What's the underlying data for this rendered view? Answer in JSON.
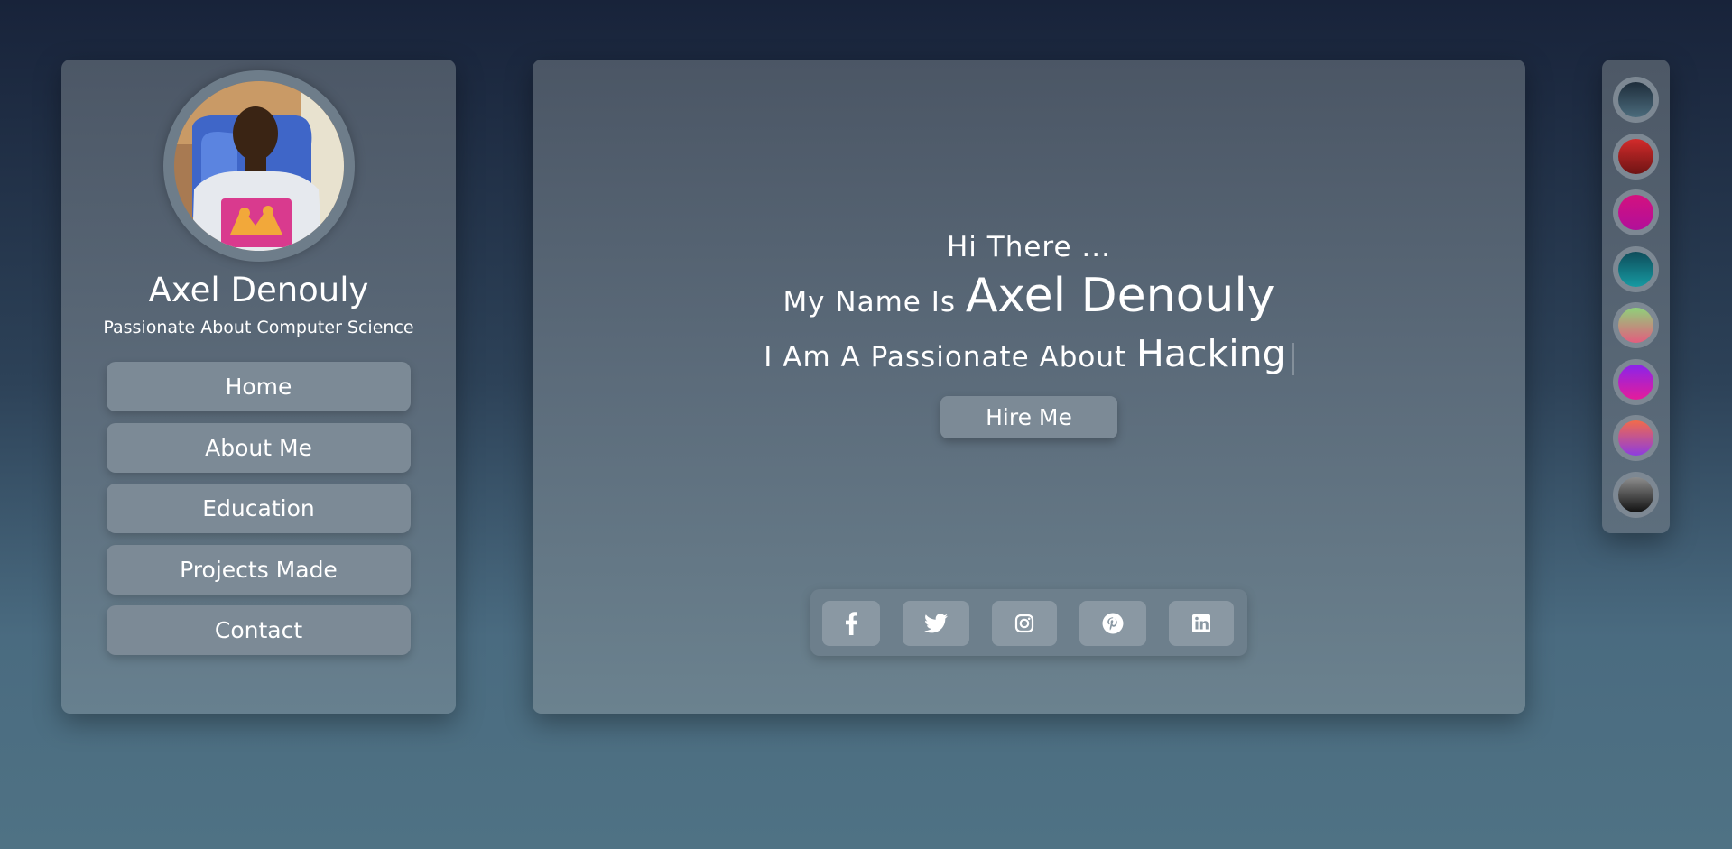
{
  "profile": {
    "name": "Axel Denouly",
    "tagline": "Passionate About Computer Science"
  },
  "nav": {
    "items": [
      {
        "label": "Home"
      },
      {
        "label": "About Me"
      },
      {
        "label": "Education"
      },
      {
        "label": "Projects Made"
      },
      {
        "label": "Contact"
      }
    ]
  },
  "hero": {
    "greeting": "Hi There ...",
    "name_prefix": "My Name Is",
    "name": "Axel Denouly",
    "passion_prefix": "I Am A Passionate About",
    "passion": "Hacking",
    "hire_label": "Hire Me"
  },
  "social": {
    "icons": [
      "facebook-icon",
      "twitter-icon",
      "instagram-icon",
      "pinterest-icon",
      "linkedin-icon"
    ]
  },
  "theme_swatches": [
    {
      "name": "swatch-slate",
      "top": "#1e2d3b",
      "bottom": "#4b6b7c"
    },
    {
      "name": "swatch-red",
      "top": "#d32b2b",
      "bottom": "#6e1414"
    },
    {
      "name": "swatch-magenta",
      "top": "#d4117f",
      "bottom": "#b1109a"
    },
    {
      "name": "swatch-teal",
      "top": "#0e4c5a",
      "bottom": "#169aa2"
    },
    {
      "name": "swatch-green-pink",
      "top": "#8fd17a",
      "bottom": "#e35d7e"
    },
    {
      "name": "swatch-purple-pink",
      "top": "#8a24ea",
      "bottom": "#e51c9b"
    },
    {
      "name": "swatch-orange-purple",
      "top": "#f26b4a",
      "bottom": "#8d3ce0"
    },
    {
      "name": "swatch-gray-black",
      "top": "#8d8d8d",
      "bottom": "#111111"
    }
  ]
}
